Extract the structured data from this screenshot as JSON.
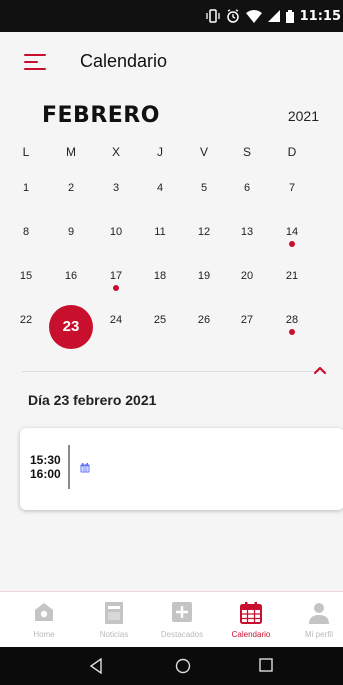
{
  "status_bar": {
    "time": "11:15"
  },
  "header": {
    "title": "Calendario"
  },
  "calendar": {
    "month": "FEBRERO",
    "year": "2021",
    "weekdays": [
      "L",
      "M",
      "X",
      "J",
      "V",
      "S",
      "D"
    ],
    "weeks": [
      [
        {
          "d": "1"
        },
        {
          "d": "2"
        },
        {
          "d": "3"
        },
        {
          "d": "4"
        },
        {
          "d": "5"
        },
        {
          "d": "6"
        },
        {
          "d": "7"
        }
      ],
      [
        {
          "d": "8"
        },
        {
          "d": "9"
        },
        {
          "d": "10"
        },
        {
          "d": "11"
        },
        {
          "d": "12"
        },
        {
          "d": "13"
        },
        {
          "d": "14",
          "event": true
        }
      ],
      [
        {
          "d": "15"
        },
        {
          "d": "16"
        },
        {
          "d": "17",
          "event": true
        },
        {
          "d": "18"
        },
        {
          "d": "19"
        },
        {
          "d": "20"
        },
        {
          "d": "21"
        }
      ],
      [
        {
          "d": "22"
        },
        {
          "d": "23",
          "selected": true
        },
        {
          "d": "24"
        },
        {
          "d": "25"
        },
        {
          "d": "26"
        },
        {
          "d": "27"
        },
        {
          "d": "28",
          "event": true
        }
      ]
    ],
    "accent_color": "#c8102e"
  },
  "selected_day": {
    "heading": "Día 23 febrero 2021",
    "events": [
      {
        "start": "15:30",
        "end": "16:00"
      }
    ]
  },
  "bottom_nav": {
    "items": [
      {
        "label": "Home",
        "icon": "home-icon"
      },
      {
        "label": "Noticias",
        "icon": "news-icon"
      },
      {
        "label": "Destacados",
        "icon": "plus-icon"
      },
      {
        "label": "Calendario",
        "icon": "calendar-icon",
        "active": true
      },
      {
        "label": "Mi perfil",
        "icon": "user-icon"
      }
    ]
  }
}
